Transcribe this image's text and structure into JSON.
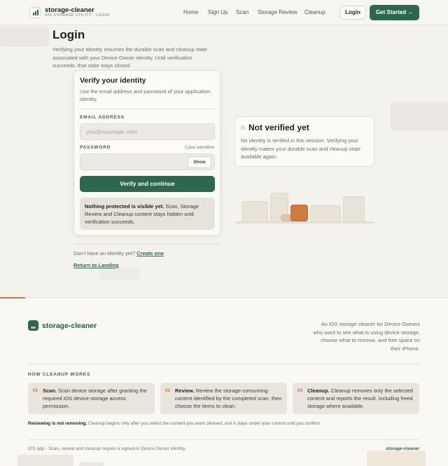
{
  "header": {
    "brand": "storage-cleaner",
    "subtitle": "iOS STORAGE UTILITY · LOGIN",
    "nav": [
      "Home",
      "Sign Up",
      "Scan",
      "Storage Review",
      "Cleanup"
    ],
    "login_label": "Login",
    "start_label": "Get Started →"
  },
  "login": {
    "title": "Login",
    "intro": "Verifying your identity resumes the durable scan and cleanup state associated with your Device Owner identity. Until verification succeeds, that state stays closed.",
    "card_title": "Verify your identity",
    "card_desc": "Use the email address and password of your application identity.",
    "email_label": "EMAIL ADDRESS",
    "email_placeholder": "you@example.com",
    "password_label": "PASSWORD",
    "case_note": "Case sensitive",
    "show_label": "Show",
    "verify_label": "Verify and continue",
    "note_bold": "Nothing protected is visible yet.",
    "note_text": " Scan, Storage Review and Cleanup content stays hidden until verification succeeds.",
    "no_account": "Don't have an identity yet? ",
    "create_label": "Create one",
    "return_label": "Return to Landing"
  },
  "status": {
    "title": "Not verified yet",
    "text": "No identity is verified in this session. Verifying your identity makes your durable scan and cleanup state available again."
  },
  "footer": {
    "brand": "storage-cleaner",
    "desc": "An iOS storage cleaner for Device Owners who want to see what is using device storage, choose what to remove, and free space on their iPhone.",
    "how_title": "HOW CLEANUP WORKS",
    "steps": [
      {
        "num": "01",
        "title": "Scan.",
        "text": " Scan device storage after granting the required iOS device-storage access permission."
      },
      {
        "num": "02",
        "title": "Review.",
        "text": " Review the storage-consuming content identified by the completed scan, then choose the items to clean."
      },
      {
        "num": "03",
        "title": "Cleanup.",
        "text": " Cleanup removes only the selected content and reports the result, including freed storage where available."
      }
    ],
    "review_bold": "Reviewing is not removing.",
    "review_text": " Cleanup begins only after you select the content you want cleaned, and it stays under your control until you confirm.",
    "bottom_text": "iOS app · Scan, review and cleanup require a signed-in Device Owner identity.",
    "bottom_brand": "storage-cleaner"
  },
  "colors": {
    "accent": "#2c684c",
    "highlight": "#d07a3f"
  }
}
